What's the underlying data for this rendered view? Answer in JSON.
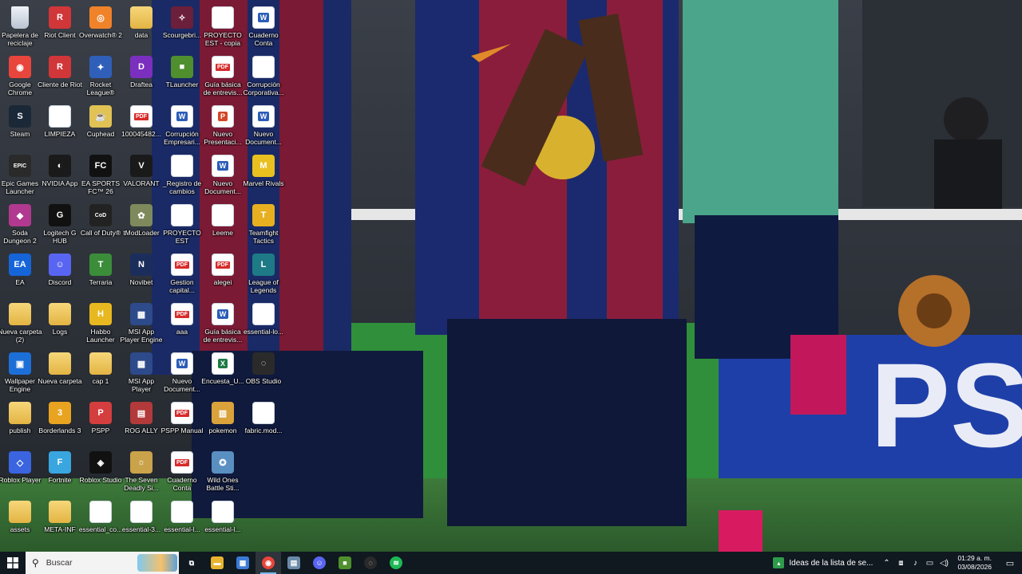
{
  "desktop": {
    "columns": [
      [
        {
          "label": "Papelera de reciclaje",
          "type": "bin",
          "icon": "recycle-bin-icon",
          "color": "#cfd8e3"
        },
        {
          "label": "Google Chrome",
          "type": "round",
          "icon": "chrome-icon",
          "color": "#e8453c",
          "glyph": "◉"
        },
        {
          "label": "Steam",
          "type": "app",
          "icon": "steam-icon",
          "color": "#1b2838",
          "glyph": "S"
        },
        {
          "label": "Epic Games Launcher",
          "type": "app",
          "icon": "epic-games-icon",
          "color": "#2a2a2a",
          "glyph": "EPIC"
        },
        {
          "label": "Soda Dungeon 2",
          "type": "app",
          "icon": "soda-dungeon-icon",
          "color": "#b1398f",
          "glyph": "◆"
        },
        {
          "label": "EA",
          "type": "round",
          "icon": "ea-icon",
          "color": "#1565d8",
          "glyph": "EA"
        },
        {
          "label": "Nueva carpeta (2)",
          "type": "folder",
          "icon": "folder-icon"
        },
        {
          "label": "Wallpaper Engine",
          "type": "app",
          "icon": "wallpaper-engine-icon",
          "color": "#1d6fd8",
          "glyph": "▣"
        },
        {
          "label": "publish",
          "type": "folder",
          "icon": "folder-icon"
        },
        {
          "label": "Roblox Player",
          "type": "app",
          "icon": "roblox-player-icon",
          "color": "#3a64e0",
          "glyph": "◇"
        },
        {
          "label": "assets",
          "type": "folder",
          "icon": "folder-icon"
        }
      ],
      [
        {
          "label": "Riot Client",
          "type": "round",
          "icon": "riot-client-icon",
          "color": "#d13639",
          "glyph": "R"
        },
        {
          "label": "Cliente de Riot",
          "type": "round",
          "icon": "riot-client-icon",
          "color": "#d13639",
          "glyph": "R"
        },
        {
          "label": "LIMPIEZA",
          "type": "txt",
          "icon": "text-file-icon",
          "glyph": "≡"
        },
        {
          "label": "NVIDIA App",
          "type": "app",
          "icon": "nvidia-icon",
          "color": "#1a1a1a",
          "glyph": "◐"
        },
        {
          "label": "Logitech G HUB",
          "type": "app",
          "icon": "logitech-icon",
          "color": "#111",
          "glyph": "G"
        },
        {
          "label": "Discord",
          "type": "round",
          "icon": "discord-icon",
          "color": "#5865f2",
          "glyph": "☺"
        },
        {
          "label": "Logs",
          "type": "folder",
          "icon": "folder-icon"
        },
        {
          "label": "Nueva carpeta",
          "type": "folder",
          "icon": "folder-icon"
        },
        {
          "label": "Borderlands 3",
          "type": "app",
          "icon": "borderlands-icon",
          "color": "#e8a320",
          "glyph": "3"
        },
        {
          "label": "Fortnite",
          "type": "app",
          "icon": "fortnite-icon",
          "color": "#39a6e0",
          "glyph": "F"
        },
        {
          "label": "META-INF",
          "type": "folder",
          "icon": "folder-icon"
        }
      ],
      [
        {
          "label": "Overwatch® 2",
          "type": "round",
          "icon": "overwatch-icon",
          "color": "#f0822a",
          "glyph": "◎"
        },
        {
          "label": "Rocket League®",
          "type": "app",
          "icon": "rocket-league-icon",
          "color": "#2f5fb8",
          "glyph": "✦"
        },
        {
          "label": "Cuphead",
          "type": "app",
          "icon": "cuphead-icon",
          "color": "#e0c255",
          "glyph": "☕"
        },
        {
          "label": "EA SPORTS FC™ 26",
          "type": "app",
          "icon": "ea-fc-icon",
          "color": "#111",
          "glyph": "FC"
        },
        {
          "label": "Call of Duty®",
          "type": "app",
          "icon": "call-of-duty-icon",
          "color": "#222",
          "glyph": "CoD"
        },
        {
          "label": "Terraria",
          "type": "app",
          "icon": "terraria-icon",
          "color": "#3b8d3a",
          "glyph": "T"
        },
        {
          "label": "Habbo Launcher",
          "type": "app",
          "icon": "habbo-icon",
          "color": "#e8b820",
          "glyph": "H"
        },
        {
          "label": "cap 1",
          "type": "folder",
          "icon": "folder-icon"
        },
        {
          "label": "PSPP",
          "type": "round",
          "icon": "pspp-icon",
          "color": "#d43e3e",
          "glyph": "P"
        },
        {
          "label": "Roblox Studio",
          "type": "app",
          "icon": "roblox-studio-icon",
          "color": "#111",
          "glyph": "◈"
        },
        {
          "label": "essential_co...",
          "type": "txt",
          "icon": "text-file-icon",
          "glyph": "≡"
        }
      ],
      [
        {
          "label": "data",
          "type": "folder",
          "icon": "folder-icon"
        },
        {
          "label": "Draftea",
          "type": "app",
          "icon": "draftea-icon",
          "color": "#7b2fbe",
          "glyph": "D"
        },
        {
          "label": "100045482...",
          "type": "pdf",
          "icon": "pdf-file-icon",
          "glyph": "PDF"
        },
        {
          "label": "VALORANT",
          "type": "app",
          "icon": "valorant-icon",
          "color": "#1a1a1a",
          "glyph": "V"
        },
        {
          "label": "tModLoader",
          "type": "app",
          "icon": "tmodloader-icon",
          "color": "#7e8a5c",
          "glyph": "✿"
        },
        {
          "label": "Novibet",
          "type": "app",
          "icon": "novibet-icon",
          "color": "#1b2d5a",
          "glyph": "N"
        },
        {
          "label": "MSI App Player Engine",
          "type": "app",
          "icon": "msi-app-player-icon",
          "color": "#2d4a8a",
          "glyph": "▦"
        },
        {
          "label": "MSI App Player",
          "type": "app",
          "icon": "msi-app-player-icon",
          "color": "#2d4a8a",
          "glyph": "▦"
        },
        {
          "label": "ROG ALLY",
          "type": "app",
          "icon": "rog-ally-icon",
          "color": "#b23a3a",
          "glyph": "▤"
        },
        {
          "label": "The Seven Deadly Si...",
          "type": "app",
          "icon": "seven-deadly-sins-icon",
          "color": "#c9a24a",
          "glyph": "☼"
        },
        {
          "label": "essential-3...",
          "type": "java",
          "icon": "java-file-icon",
          "glyph": "♨"
        }
      ],
      [
        {
          "label": "Scourgebri...",
          "type": "app",
          "icon": "scourgebringer-icon",
          "color": "#6b1f3a",
          "glyph": "✧"
        },
        {
          "label": "TLauncher",
          "type": "app",
          "icon": "tlauncher-icon",
          "color": "#4f8f2e",
          "glyph": "■"
        },
        {
          "label": "Corrupción Empresari...",
          "type": "word",
          "icon": "word-file-icon",
          "glyph": "W"
        },
        {
          "label": "_Registro de cambios",
          "type": "txt",
          "icon": "text-file-icon",
          "glyph": "≡"
        },
        {
          "label": "PROYECTO EST",
          "type": "txt",
          "icon": "text-file-icon",
          "glyph": "∿"
        },
        {
          "label": "Gestion capital...",
          "type": "pdf",
          "icon": "pdf-file-icon",
          "glyph": "PDF"
        },
        {
          "label": "aaa",
          "type": "pdf",
          "icon": "pdf-file-icon",
          "glyph": "PDF"
        },
        {
          "label": "Nuevo Document...",
          "type": "word",
          "icon": "word-file-icon",
          "glyph": "W"
        },
        {
          "label": "PSPP Manual",
          "type": "pdf",
          "icon": "pdf-file-icon",
          "glyph": "PDF"
        },
        {
          "label": "Cuaderno Conta",
          "type": "pdf",
          "icon": "pdf-file-icon",
          "glyph": "PDF"
        },
        {
          "label": "essential-l...",
          "type": "java",
          "icon": "java-file-icon",
          "glyph": "♨"
        }
      ],
      [
        {
          "label": "PROYECTO EST - copia",
          "type": "txt",
          "icon": "text-file-icon",
          "glyph": "∿"
        },
        {
          "label": "Guía básica de entrevis...",
          "type": "pdf",
          "icon": "pdf-file-icon",
          "glyph": "PDF"
        },
        {
          "label": "Nuevo Presentaci...",
          "type": "ppt",
          "icon": "powerpoint-file-icon",
          "glyph": "P"
        },
        {
          "label": "Nuevo Document...",
          "type": "word",
          "icon": "word-file-icon",
          "glyph": "W"
        },
        {
          "label": "Leeme",
          "type": "txt",
          "icon": "text-file-icon",
          "glyph": "≡"
        },
        {
          "label": "alegei",
          "type": "pdf",
          "icon": "pdf-file-icon",
          "glyph": "PDF"
        },
        {
          "label": "Guía básica de entrevis...",
          "type": "word",
          "icon": "word-file-icon",
          "glyph": "W"
        },
        {
          "label": "Encuesta_U...",
          "type": "excel",
          "icon": "excel-file-icon",
          "glyph": "X"
        },
        {
          "label": "pokemon",
          "type": "app",
          "icon": "pokemon-icon",
          "color": "#d9a23a",
          "glyph": "▥"
        },
        {
          "label": "Wild Ones Battle Sti...",
          "type": "app",
          "icon": "wild-ones-icon",
          "color": "#5a8fc2",
          "glyph": "✪"
        },
        {
          "label": "essential-l...",
          "type": "txt",
          "icon": "text-file-icon",
          "glyph": "≡"
        }
      ],
      [
        {
          "label": "Cuaderno Conta",
          "type": "word",
          "icon": "word-file-icon",
          "glyph": "W"
        },
        {
          "label": "Corrupción Corporativa...",
          "type": "txt",
          "icon": "text-file-icon",
          "glyph": ""
        },
        {
          "label": "Nuevo Document...",
          "type": "word",
          "icon": "word-file-icon",
          "glyph": "W"
        },
        {
          "label": "Marvel Rivals",
          "type": "app",
          "icon": "marvel-rivals-icon",
          "color": "#e8c020",
          "glyph": "M"
        },
        {
          "label": "Teamfight Tactics",
          "type": "app",
          "icon": "teamfight-tactics-icon",
          "color": "#e8b020",
          "glyph": "T"
        },
        {
          "label": "League of Legends",
          "type": "round",
          "icon": "league-of-legends-icon",
          "color": "#1e7a86",
          "glyph": "L"
        },
        {
          "label": "essential-lo...",
          "type": "txt",
          "icon": "text-file-icon",
          "glyph": "≡"
        },
        {
          "label": "OBS Studio",
          "type": "round",
          "icon": "obs-studio-icon",
          "color": "#2a2a2a",
          "glyph": "◌"
        },
        {
          "label": "fabric.mod...",
          "type": "txt",
          "icon": "text-file-icon",
          "glyph": "≡"
        }
      ]
    ]
  },
  "taskbar": {
    "search_placeholder": "Buscar",
    "pinned": [
      {
        "name": "task-view-icon",
        "glyph": "⧉",
        "color": "transparent"
      },
      {
        "name": "file-explorer-icon",
        "glyph": "▬",
        "color": "#e8b430"
      },
      {
        "name": "microsoft-store-icon",
        "glyph": "▦",
        "color": "#3c7bd6"
      },
      {
        "name": "chrome-icon",
        "glyph": "◉",
        "color": "#e8453c",
        "active": true
      },
      {
        "name": "notepad-icon",
        "glyph": "▤",
        "color": "#6a8aa8"
      },
      {
        "name": "discord-icon",
        "glyph": "☺",
        "color": "#5865f2"
      },
      {
        "name": "minecraft-icon",
        "glyph": "■",
        "color": "#4f8f2e"
      },
      {
        "name": "obs-studio-icon",
        "glyph": "◌",
        "color": "#2a2a2a"
      },
      {
        "name": "spotify-icon",
        "glyph": "≋",
        "color": "#1db954"
      }
    ],
    "news": "Ideas de la lista de se...",
    "clock_time": "01:29 a. m.",
    "clock_date": "03/08/2026"
  }
}
